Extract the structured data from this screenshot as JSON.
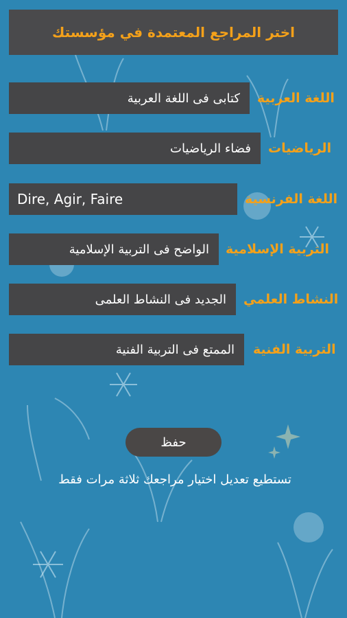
{
  "header": {
    "title": "اختر المراجع المعتمدة في مؤسستك"
  },
  "subjects": [
    {
      "label": "اللغة العربية",
      "value": "كتابى فى اللغة العربية"
    },
    {
      "label": "الرياضيات",
      "value": "فضاء الرياضيات"
    },
    {
      "label": "اللغة الفرنسية",
      "value": "Dire, Agir, Faire"
    },
    {
      "label": "التربية الإسلامية",
      "value": "الواضح فى التربية الإسلامية"
    },
    {
      "label": "النشاط العلمي",
      "value": "الجديد فى النشاط العلمى"
    },
    {
      "label": "التربية الفنية",
      "value": "الممتع فى التربية الفنية"
    }
  ],
  "save_button": {
    "label": "حفظ"
  },
  "footer_note": "تستطيع تعديل اختيار مراجعك ثلاثة مرات فقط",
  "colors": {
    "background": "#2d86b3",
    "accent": "#f4a11a",
    "panel": "#454547"
  }
}
